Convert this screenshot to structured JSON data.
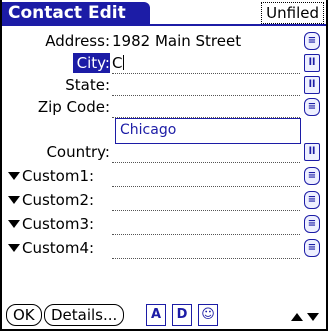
{
  "titlebar": {
    "title": "Contact Edit",
    "category": "Unfiled"
  },
  "fields": {
    "address": {
      "label": "Address:",
      "value": "1982 Main Street"
    },
    "city": {
      "label": "City:",
      "value": "C"
    },
    "state": {
      "label": "State:",
      "value": ""
    },
    "zip": {
      "label": "Zip Code:",
      "value": ""
    },
    "country": {
      "label": "Country:",
      "value": ""
    },
    "custom1": {
      "label": "Custom1:",
      "value": ""
    },
    "custom2": {
      "label": "Custom2:",
      "value": ""
    },
    "custom3": {
      "label": "Custom3:",
      "value": ""
    },
    "custom4": {
      "label": "Custom4:",
      "value": ""
    }
  },
  "suggestion": "Chicago",
  "buttons": {
    "ok": "OK",
    "details": "Details...",
    "a": "A",
    "d": "D"
  },
  "side_icons": {
    "address": "≡",
    "city": "ll",
    "state": "ll",
    "zip": "≡",
    "country": "ll",
    "custom1": "≡",
    "custom2": "≡",
    "custom3": "≡",
    "custom4": "≡"
  },
  "colors": {
    "accent": "#1c1ca6"
  }
}
